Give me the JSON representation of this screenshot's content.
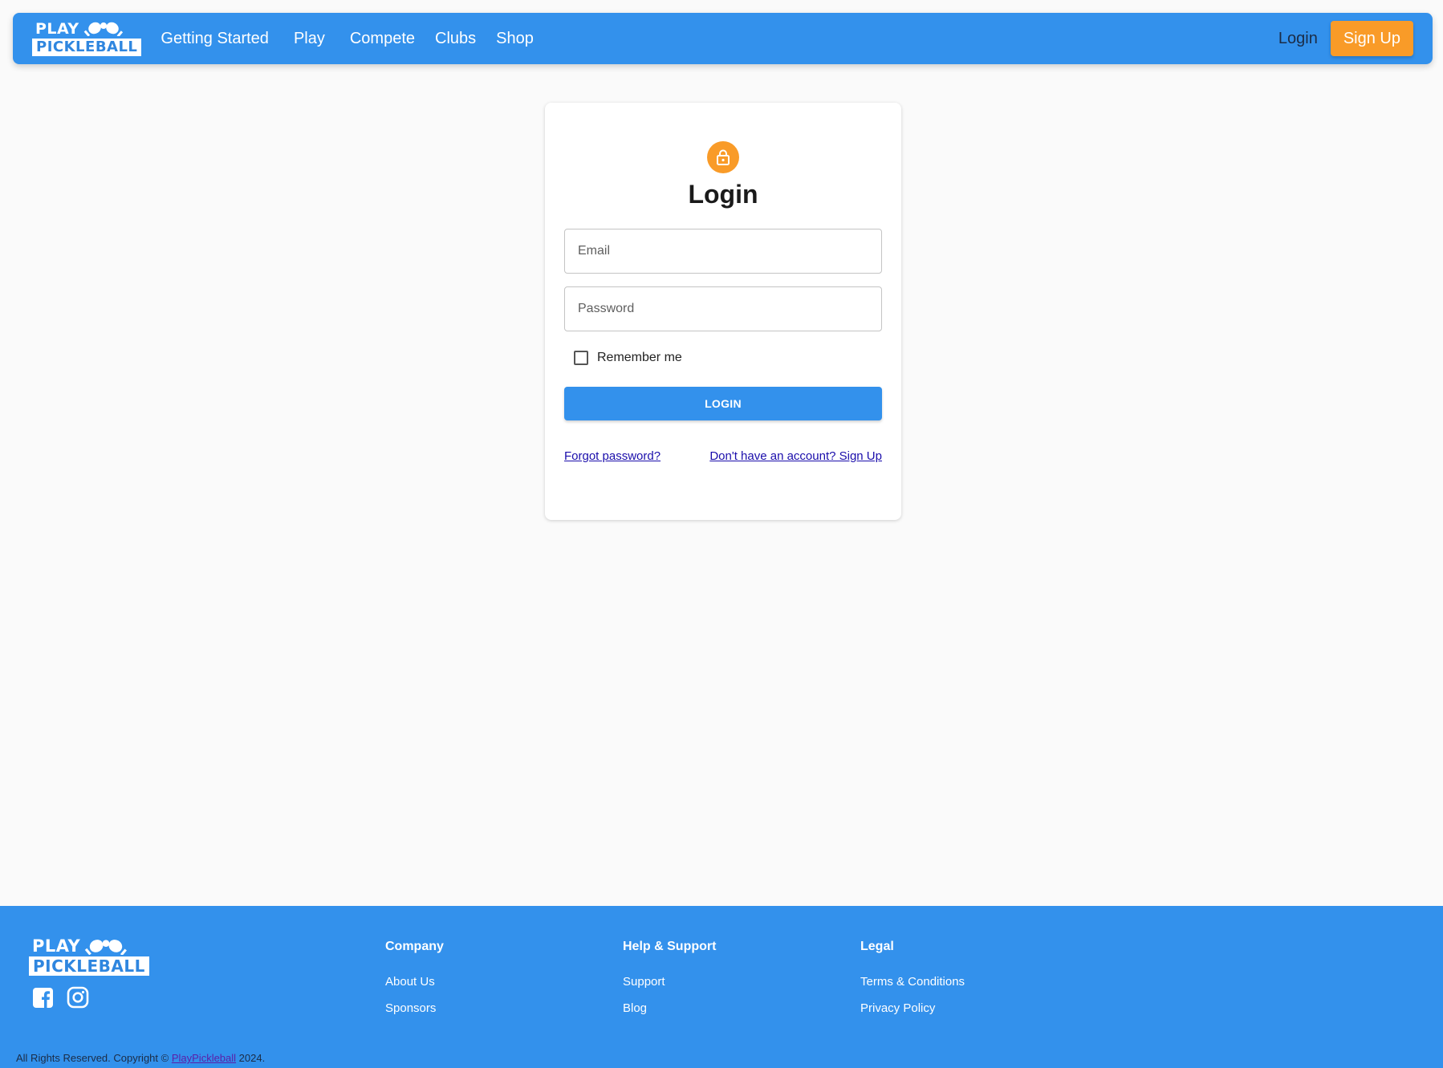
{
  "brand": {
    "logo_top": "PLAY",
    "logo_bottom": "PICKLEBALL",
    "primary_color": "#3391ec",
    "accent_color": "#f99b28"
  },
  "header": {
    "nav": [
      "Getting Started",
      "Play",
      "Compete",
      "Clubs",
      "Shop"
    ],
    "login_label": "Login",
    "signup_label": "Sign Up"
  },
  "login_card": {
    "icon": "lock-icon",
    "title": "Login",
    "email_placeholder": "Email",
    "email_value": "",
    "password_placeholder": "Password",
    "password_value": "",
    "remember_label": "Remember me",
    "remember_checked": false,
    "submit_label": "LOGIN",
    "forgot_label": "Forgot password?",
    "signup_prompt": "Don't have an account? Sign Up"
  },
  "footer": {
    "social": [
      "facebook-icon",
      "instagram-icon"
    ],
    "columns": [
      {
        "title": "Company",
        "links": [
          "About Us",
          "Sponsors"
        ]
      },
      {
        "title": "Help & Support",
        "links": [
          "Support",
          "Blog"
        ]
      },
      {
        "title": "Legal",
        "links": [
          "Terms & Conditions",
          "Privacy Policy"
        ]
      }
    ],
    "copyright_prefix": "All Rights Reserved. Copyright ©",
    "copyright_link": "PlayPickleball",
    "copyright_suffix": "2024."
  }
}
